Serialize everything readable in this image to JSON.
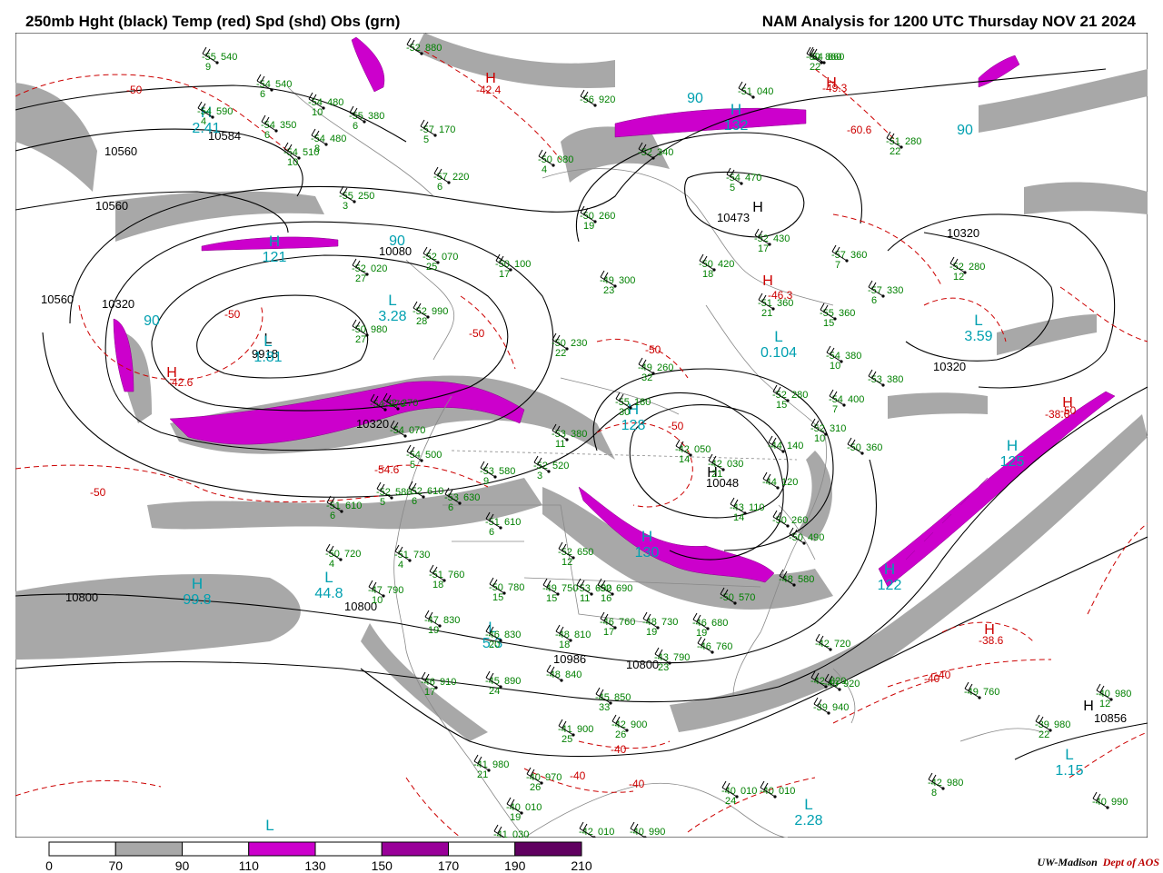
{
  "header": {
    "title_left": "250mb Hght (black) Temp (red) Spd (shd) Obs (grn)",
    "title_right": "NAM Analysis for 1200 UTC Thursday  NOV 21 2024"
  },
  "colors": {
    "height_contours": "#000000",
    "temperature_contours": "#cc0000",
    "observations": "#008000",
    "speed_centers": "#00a0b0",
    "speed_70_90": "#a8a8a8",
    "speed_110_130": "#cc00cc",
    "geography": "#888888"
  },
  "height_labels": [
    {
      "text": "10584"
    },
    {
      "text": "10560"
    },
    {
      "text": "10560"
    },
    {
      "text": "10560"
    },
    {
      "text": "10320"
    },
    {
      "text": "10080"
    },
    {
      "text": "9918"
    },
    {
      "text": "10473"
    },
    {
      "text": "10320"
    },
    {
      "text": "10320"
    },
    {
      "text": "10320"
    },
    {
      "text": "10048"
    },
    {
      "text": "10800"
    },
    {
      "text": "10800"
    },
    {
      "text": "10800"
    },
    {
      "text": "10856"
    },
    {
      "text": "10986"
    }
  ],
  "temp_labels": [
    {
      "text": "-50"
    },
    {
      "text": "-42.4"
    },
    {
      "text": "-49.3"
    },
    {
      "text": "-60.6"
    },
    {
      "text": "-50"
    },
    {
      "text": "-42.6"
    },
    {
      "text": "-46.3"
    },
    {
      "text": "-50"
    },
    {
      "text": "-50"
    },
    {
      "text": "-50"
    },
    {
      "text": "-54.6"
    },
    {
      "text": "-50"
    },
    {
      "text": "-50"
    },
    {
      "text": "-38.6"
    },
    {
      "text": "-40"
    },
    {
      "text": "-40"
    },
    {
      "text": "-40"
    },
    {
      "text": "-40"
    },
    {
      "text": "-38.6"
    },
    {
      "text": "-40"
    }
  ],
  "pressure_centers": [
    {
      "letter": "H",
      "color": "red"
    },
    {
      "letter": "H",
      "color": "red"
    },
    {
      "letter": "H",
      "color": "red"
    },
    {
      "letter": "H",
      "color": "red"
    },
    {
      "letter": "H",
      "color": "red"
    },
    {
      "letter": "H",
      "color": "red"
    },
    {
      "letter": "L",
      "color": "black"
    },
    {
      "letter": "H",
      "color": "black"
    },
    {
      "letter": "H",
      "color": "black"
    },
    {
      "letter": "H",
      "color": "black"
    }
  ],
  "speed_centers": [
    {
      "letter": "H",
      "value": "2.41"
    },
    {
      "letter": "",
      "value": "90"
    },
    {
      "letter": "H",
      "value": "132"
    },
    {
      "letter": "",
      "value": "90"
    },
    {
      "letter": "H",
      "value": "121"
    },
    {
      "letter": "L",
      "value": "3.28"
    },
    {
      "letter": "L",
      "value": "1.81"
    },
    {
      "letter": "L",
      "value": "0.104"
    },
    {
      "letter": "L",
      "value": "3.59"
    },
    {
      "letter": "H",
      "value": "125"
    },
    {
      "letter": "H",
      "value": "122"
    },
    {
      "letter": "H",
      "value": "99.8"
    },
    {
      "letter": "L",
      "value": "44.8"
    },
    {
      "letter": "L",
      "value": "1.15"
    },
    {
      "letter": "L",
      "value": "2.28"
    },
    {
      "letter": "H",
      "value": "128"
    },
    {
      "letter": "H",
      "value": "130"
    },
    {
      "letter": "L",
      "value": "5.3"
    },
    {
      "letter": "",
      "value": "90"
    },
    {
      "letter": "",
      "value": "90"
    },
    {
      "letter": "L",
      "value": ""
    }
  ],
  "observations": [
    {
      "t": "-55",
      "h": "540",
      "d": "9"
    },
    {
      "t": "-54",
      "h": "540",
      "d": "6"
    },
    {
      "t": "-54",
      "h": "590",
      "d": "4"
    },
    {
      "t": "-54",
      "h": "480",
      "d": "10"
    },
    {
      "t": "-55",
      "h": "380",
      "d": "6"
    },
    {
      "t": "-54",
      "h": "350",
      "d": "6"
    },
    {
      "t": "-54",
      "h": "480",
      "d": "8"
    },
    {
      "t": "-54",
      "h": "510",
      "d": "10"
    },
    {
      "t": "-57",
      "h": "170",
      "d": "5"
    },
    {
      "t": "-57",
      "h": "220",
      "d": "6"
    },
    {
      "t": "-55",
      "h": "250",
      "d": "3"
    },
    {
      "t": "-56",
      "h": "920",
      "d": ""
    },
    {
      "t": "-50",
      "h": "080",
      "d": "4"
    },
    {
      "t": "-52",
      "h": "340",
      "d": ""
    },
    {
      "t": "-51",
      "h": "040",
      "d": ""
    },
    {
      "t": "-54",
      "h": "470",
      "d": "5"
    },
    {
      "t": "-51",
      "h": "280",
      "d": "22"
    },
    {
      "t": "-50",
      "h": "860",
      "d": "22"
    },
    {
      "t": "-52",
      "h": "070",
      "d": "25"
    },
    {
      "t": "-52",
      "h": "020",
      "d": "27"
    },
    {
      "t": "-52",
      "h": "990",
      "d": "28"
    },
    {
      "t": "-50",
      "h": "980",
      "d": "27"
    },
    {
      "t": "-50",
      "h": "100",
      "d": "17"
    },
    {
      "t": "-50",
      "h": "260",
      "d": "19"
    },
    {
      "t": "-49",
      "h": "300",
      "d": "23"
    },
    {
      "t": "-50",
      "h": "420",
      "d": "18"
    },
    {
      "t": "-52",
      "h": "430",
      "d": "17"
    },
    {
      "t": "-57",
      "h": "360",
      "d": "7"
    },
    {
      "t": "-52",
      "h": "280",
      "d": "12"
    },
    {
      "t": "-57",
      "h": "330",
      "d": "6"
    },
    {
      "t": "-51",
      "h": "360",
      "d": "21"
    },
    {
      "t": "-55",
      "h": "360",
      "d": "15"
    },
    {
      "t": "-50",
      "h": "230",
      "d": "22"
    },
    {
      "t": "-49",
      "h": "260",
      "d": "32"
    },
    {
      "t": "-54",
      "h": "380",
      "d": "10"
    },
    {
      "t": "-53",
      "h": "380",
      "d": ""
    },
    {
      "t": "-52",
      "h": "280",
      "d": "15"
    },
    {
      "t": "-54",
      "h": "400",
      "d": "7"
    },
    {
      "t": "-52",
      "h": "310",
      "d": "10"
    },
    {
      "t": "-50",
      "h": "360",
      "d": ""
    },
    {
      "t": "-55",
      "h": "180",
      "d": "30"
    },
    {
      "t": "-53",
      "h": "380",
      "d": "11"
    },
    {
      "t": "-42",
      "h": "050",
      "d": "14"
    },
    {
      "t": "-42",
      "h": "030",
      "d": "21"
    },
    {
      "t": "-44",
      "h": "120",
      "d": ""
    },
    {
      "t": "-44",
      "h": "140",
      "d": ""
    },
    {
      "t": "-43",
      "h": "110",
      "d": "14"
    },
    {
      "t": "-54",
      "h": "500",
      "d": "5"
    },
    {
      "t": "-52",
      "h": "580",
      "d": "5"
    },
    {
      "t": "-51",
      "h": "610",
      "d": "6"
    },
    {
      "t": "-52",
      "h": "610",
      "d": "6"
    },
    {
      "t": "-53",
      "h": "630",
      "d": "6"
    },
    {
      "t": "-53",
      "h": "580",
      "d": "9"
    },
    {
      "t": "-51",
      "h": "610",
      "d": "6"
    },
    {
      "t": "-52",
      "h": "520",
      "d": "3"
    },
    {
      "t": "-50",
      "h": "720",
      "d": "4"
    },
    {
      "t": "-51",
      "h": "730",
      "d": "4"
    },
    {
      "t": "-51",
      "h": "760",
      "d": "18"
    },
    {
      "t": "-52",
      "h": "650",
      "d": "12"
    },
    {
      "t": "-53",
      "h": "690",
      "d": "11"
    },
    {
      "t": "-50",
      "h": "780",
      "d": "15"
    },
    {
      "t": "-49",
      "h": "750",
      "d": "15"
    },
    {
      "t": "-52",
      "h": "690",
      "d": "16"
    },
    {
      "t": "-47",
      "h": "790",
      "d": "10"
    },
    {
      "t": "-47",
      "h": "830",
      "d": "19"
    },
    {
      "t": "-46",
      "h": "830",
      "d": "20"
    },
    {
      "t": "-48",
      "h": "810",
      "d": "18"
    },
    {
      "t": "-46",
      "h": "760",
      "d": "17"
    },
    {
      "t": "-48",
      "h": "730",
      "d": "19"
    },
    {
      "t": "-46",
      "h": "680",
      "d": "19"
    },
    {
      "t": "-50",
      "h": "570",
      "d": ""
    },
    {
      "t": "-48",
      "h": "580",
      "d": ""
    },
    {
      "t": "-50",
      "h": "260",
      "d": ""
    },
    {
      "t": "-50",
      "h": "490",
      "d": ""
    },
    {
      "t": "-42",
      "h": "720",
      "d": ""
    },
    {
      "t": "-42",
      "h": "820",
      "d": ""
    },
    {
      "t": "-46",
      "h": "910",
      "d": "17"
    },
    {
      "t": "-45",
      "h": "890",
      "d": "24"
    },
    {
      "t": "-48",
      "h": "840",
      "d": ""
    },
    {
      "t": "-45",
      "h": "850",
      "d": "33"
    },
    {
      "t": "-41",
      "h": "900",
      "d": "25"
    },
    {
      "t": "-42",
      "h": "900",
      "d": "26"
    },
    {
      "t": "-43",
      "h": "790",
      "d": "23"
    },
    {
      "t": "-46",
      "h": "760",
      "d": ""
    },
    {
      "t": "-40",
      "h": "920",
      "d": ""
    },
    {
      "t": "-39",
      "h": "940",
      "d": ""
    },
    {
      "t": "-41",
      "h": "980",
      "d": "21"
    },
    {
      "t": "-40",
      "h": "970",
      "d": "26"
    },
    {
      "t": "-40",
      "h": "010",
      "d": "19"
    },
    {
      "t": "-41",
      "h": "030",
      "d": ""
    },
    {
      "t": "-42",
      "h": "010",
      "d": ""
    },
    {
      "t": "-40",
      "h": "990",
      "d": ""
    },
    {
      "t": "-40",
      "h": "010",
      "d": "24"
    },
    {
      "t": "-40",
      "h": "010",
      "d": ""
    },
    {
      "t": "-42",
      "h": "980",
      "d": "8"
    },
    {
      "t": "-40",
      "h": "990",
      "d": ""
    },
    {
      "t": "-39",
      "h": "980",
      "d": "22"
    },
    {
      "t": "-40",
      "h": "980",
      "d": "12"
    },
    {
      "t": "-49",
      "h": "760",
      "d": ""
    },
    {
      "t": "-54",
      "h": "860",
      "d": ""
    },
    {
      "t": "-52",
      "h": "880",
      "d": ""
    },
    {
      "t": "-52",
      "h": "270",
      "d": ""
    },
    {
      "t": "-54",
      "h": "070",
      "d": ""
    },
    {
      "t": "-54",
      "h": "270",
      "d": ""
    }
  ],
  "legend": {
    "labels": [
      "0",
      "70",
      "90",
      "110",
      "130",
      "150",
      "170",
      "190",
      "210"
    ],
    "colors": [
      "#ffffff",
      "#a8a8a8",
      "#ffffff",
      "#cc00cc",
      "#ffffff",
      "#990099",
      "#ffffff",
      "#600060"
    ]
  },
  "footer": {
    "credit": "UW-Madison",
    "dept": "Dept of AOS"
  }
}
